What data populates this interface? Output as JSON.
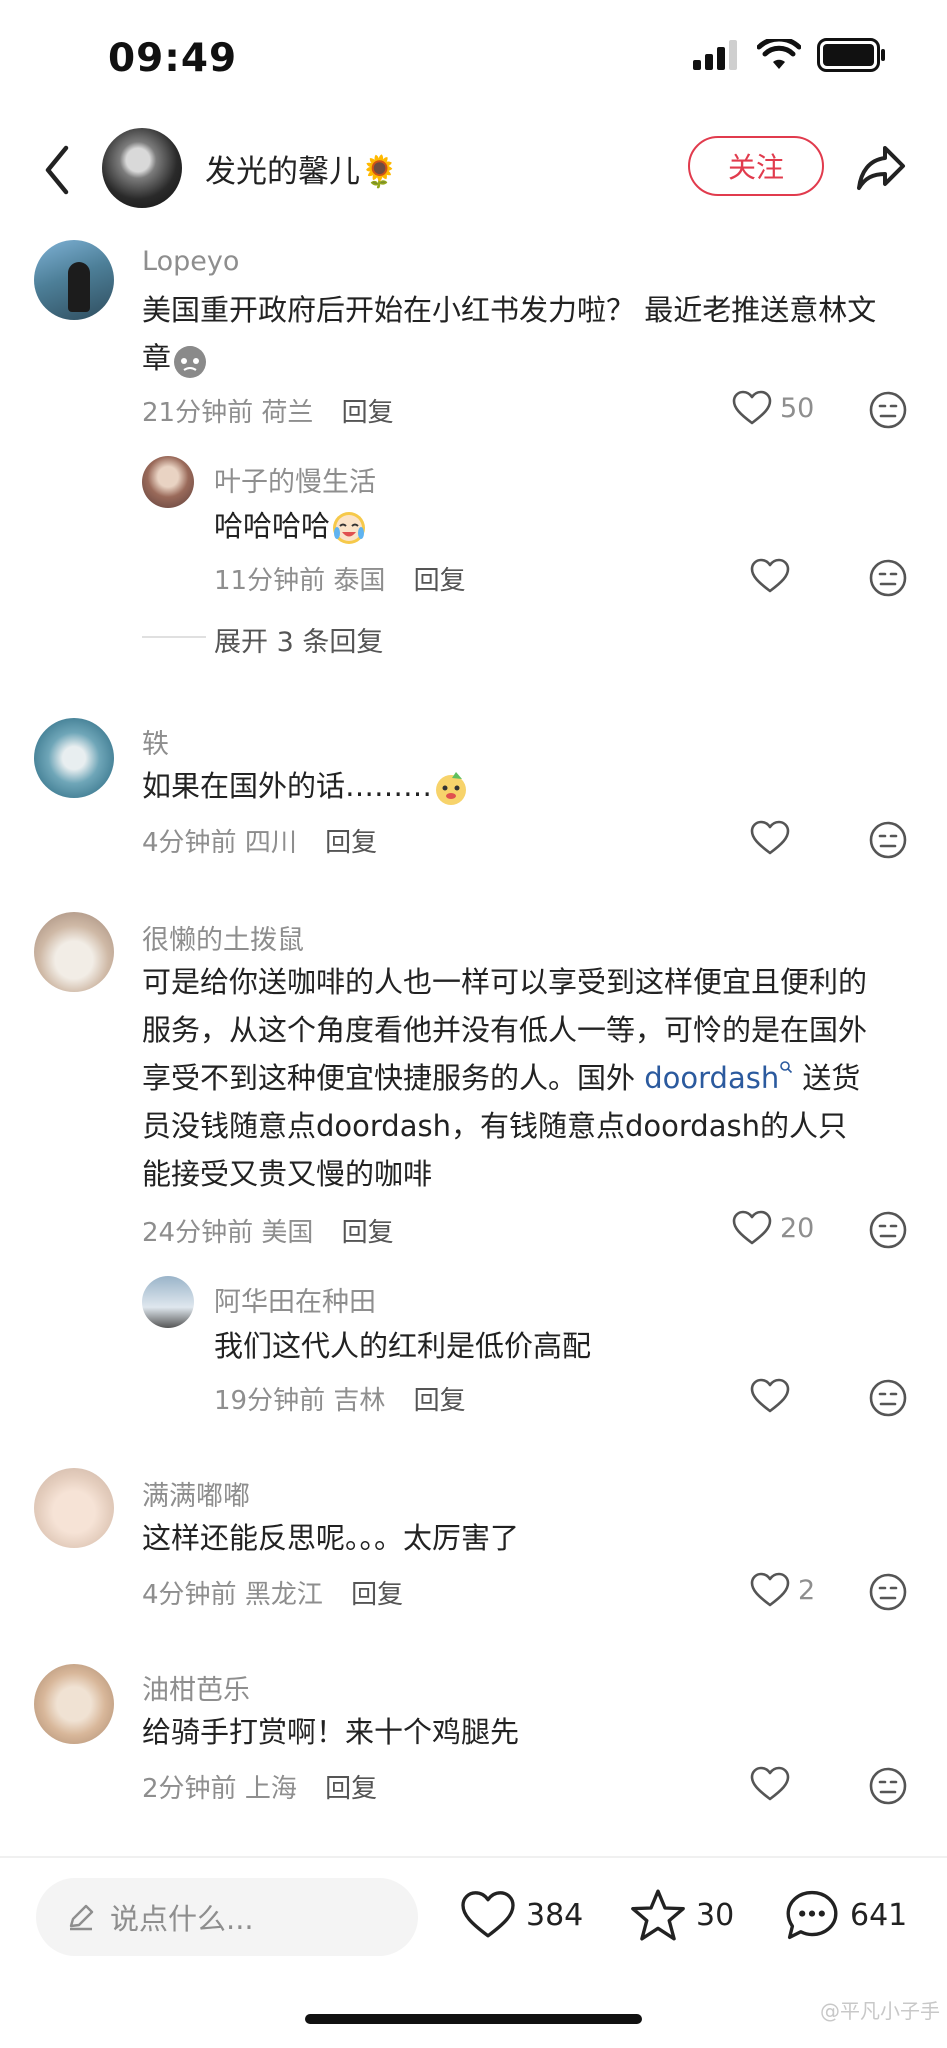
{
  "status_bar": {
    "time": "09:49"
  },
  "header": {
    "author_name": "发光的馨儿🌻",
    "follow_label": "关注"
  },
  "comments": [
    {
      "name": "Lopeyo",
      "text": "美国重开政府后开始在小红书发力啦？ 最近老推送意林文章",
      "time": "21分钟前",
      "location": "荷兰",
      "reply": "回复",
      "likes": "50",
      "replies": [
        {
          "name": "叶子的慢生活",
          "text": "哈哈哈哈",
          "time": "11分钟前",
          "location": "泰国",
          "reply": "回复",
          "likes": ""
        }
      ],
      "expand": "展开 3 条回复"
    },
    {
      "name": "轶",
      "text": "如果在国外的话………",
      "time": "4分钟前",
      "location": "四川",
      "reply": "回复",
      "likes": ""
    },
    {
      "name": "很懒的土拨鼠",
      "text_lines": [
        "可是给你送咖啡的人也一样可以享受到这样便宜且便利的",
        "服务，从这个角度看他并没有低人一等，可怜的是在国外",
        "享受不到这种便宜快捷服务的人。国外 ",
        "员没钱随意点doordash，有钱随意点doordash的人只",
        "能接受又贵又慢的咖啡"
      ],
      "link_text": "doordash",
      "link_after": " 送货",
      "time": "24分钟前",
      "location": "美国",
      "reply": "回复",
      "likes": "20",
      "replies": [
        {
          "name": "阿华田在种田",
          "text": "我们这代人的红利是低价高配",
          "time": "19分钟前",
          "location": "吉林",
          "reply": "回复",
          "likes": ""
        }
      ]
    },
    {
      "name": "满满嘟嘟",
      "text": "这样还能反思呢。。。太厉害了",
      "time": "4分钟前",
      "location": "黑龙江",
      "reply": "回复",
      "likes": "2"
    },
    {
      "name": "油柑芭乐",
      "text": "给骑手打赏啊！来十个鸡腿先",
      "time": "2分钟前",
      "location": "上海",
      "reply": "回复",
      "likes": ""
    }
  ],
  "bottom_bar": {
    "input_placeholder": "说点什么...",
    "likes": "384",
    "stars": "30",
    "comments": "641"
  },
  "watermark": "@平凡小子手"
}
